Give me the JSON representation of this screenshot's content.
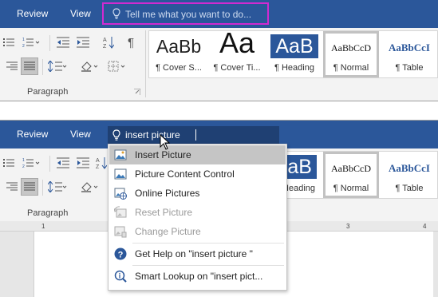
{
  "colors": {
    "ribbon_blue": "#2b579a",
    "highlight_callout": "#d12ad1",
    "menu_highlight": "#c5c5c5"
  },
  "top": {
    "tabs": {
      "review": "Review",
      "view": "View"
    },
    "tellme_placeholder": "Tell me what you want to do...",
    "group_label": "Paragraph",
    "styles": [
      {
        "sample": "AaBb",
        "label": "¶ Cover S..."
      },
      {
        "sample": "Aa",
        "label": "¶ Cover Ti..."
      },
      {
        "sample": "AaB",
        "label": "¶ Heading"
      },
      {
        "sample": "AaBbCcD",
        "label": "¶ Normal"
      },
      {
        "sample": "AaBbCcI",
        "label": "¶ Table"
      }
    ]
  },
  "bottom": {
    "tabs": {
      "review": "Review",
      "view": "View"
    },
    "search_value": "insert picture",
    "group_label": "Paragraph",
    "styles": [
      {
        "sample": "aB",
        "label": "Heading"
      },
      {
        "sample": "AaBbCcD",
        "label": "¶ Normal"
      },
      {
        "sample": "AaBbCcI",
        "label": "¶ Table"
      }
    ],
    "ruler_marks": [
      "1",
      "3",
      "4"
    ],
    "menu": {
      "items": [
        {
          "label": "Insert Picture",
          "icon": "insert-picture-icon"
        },
        {
          "label": "Picture Content Control",
          "icon": "picture-content-control-icon"
        },
        {
          "label": "Online Pictures",
          "icon": "online-pictures-icon"
        },
        {
          "label": "Reset Picture",
          "icon": "reset-picture-icon"
        },
        {
          "label": "Change Picture",
          "icon": "change-picture-icon"
        },
        {
          "label": "Get Help on \"insert picture \"",
          "icon": "help-icon"
        },
        {
          "label": "Smart Lookup on \"insert pict...",
          "icon": "smart-lookup-icon"
        }
      ]
    }
  }
}
